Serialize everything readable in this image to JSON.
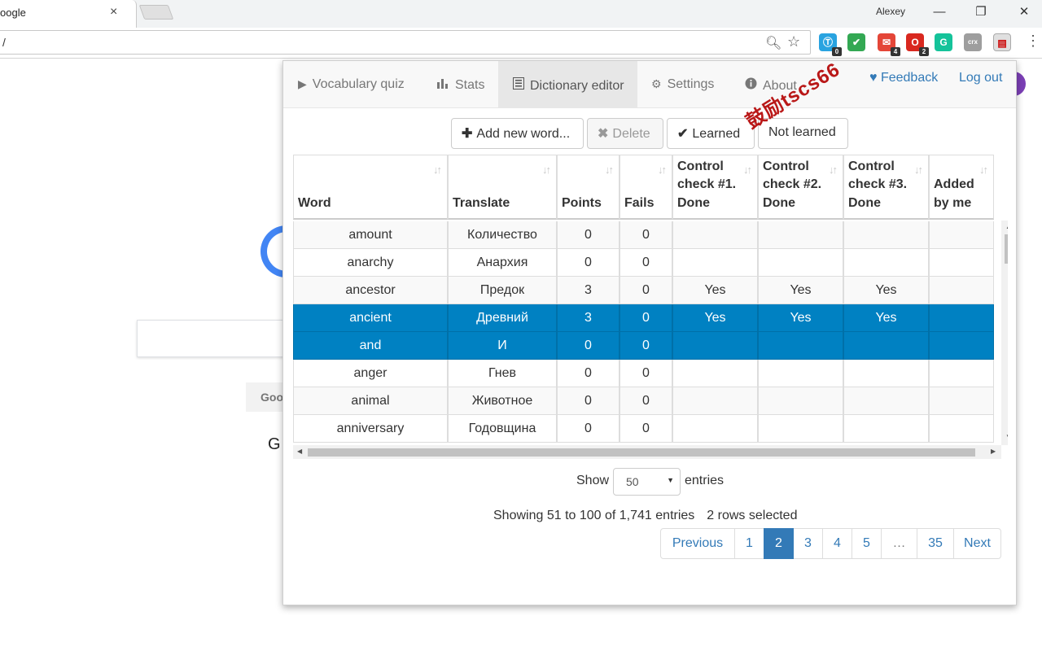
{
  "browser": {
    "tab_title": "oogle",
    "tab_close": "×",
    "profile_name": "Alexey",
    "minimize": "—",
    "restore": "❐",
    "close": "✕",
    "address": "/",
    "menu": "⋮",
    "extensions": [
      {
        "name": "translate-ext",
        "badge": "0",
        "color": "#29a3e0"
      },
      {
        "name": "check-ext",
        "badge": "",
        "color": "#33a853"
      },
      {
        "name": "mail-ext",
        "badge": "4",
        "color": "#e44638"
      },
      {
        "name": "opera-ext",
        "badge": "2",
        "color": "#d9281f"
      },
      {
        "name": "grammarly-ext",
        "badge": "",
        "color": "#15c39a"
      },
      {
        "name": "crx-ext",
        "badge": "",
        "color": "#9e9e9e"
      },
      {
        "name": "dictionary-ext",
        "badge": "",
        "color": "#e0e0e0"
      }
    ]
  },
  "google_page": {
    "button_fragment": "Goo",
    "text_fragment": "G"
  },
  "popup": {
    "nav": {
      "quiz": "Vocabulary quiz",
      "stats": "Stats",
      "editor": "Dictionary editor",
      "settings": "Settings",
      "about": "About",
      "feedback": "Feedback",
      "logout": "Log out"
    },
    "watermark": "鼓励tscs66",
    "toolbar": {
      "add": "Add new word...",
      "delete": "Delete",
      "learned": "Learned",
      "not_learned": "Not learned"
    },
    "table": {
      "columns": [
        "Word",
        "Translate",
        "Points",
        "Fails",
        "Control check #1. Done",
        "Control check #2. Done",
        "Control check #3. Done",
        "Added by me"
      ],
      "rows": [
        {
          "word": "amount",
          "translate": "Количество",
          "points": "0",
          "fails": "0",
          "c1": "",
          "c2": "",
          "c3": "",
          "added": "",
          "selected": false
        },
        {
          "word": "anarchy",
          "translate": "Анархия",
          "points": "0",
          "fails": "0",
          "c1": "",
          "c2": "",
          "c3": "",
          "added": "",
          "selected": false
        },
        {
          "word": "ancestor",
          "translate": "Предок",
          "points": "3",
          "fails": "0",
          "c1": "Yes",
          "c2": "Yes",
          "c3": "Yes",
          "added": "",
          "selected": false
        },
        {
          "word": "ancient",
          "translate": "Древний",
          "points": "3",
          "fails": "0",
          "c1": "Yes",
          "c2": "Yes",
          "c3": "Yes",
          "added": "",
          "selected": true
        },
        {
          "word": "and",
          "translate": "И",
          "points": "0",
          "fails": "0",
          "c1": "",
          "c2": "",
          "c3": "",
          "added": "",
          "selected": true
        },
        {
          "word": "anger",
          "translate": "Гнев",
          "points": "0",
          "fails": "0",
          "c1": "",
          "c2": "",
          "c3": "",
          "added": "",
          "selected": false
        },
        {
          "word": "animal",
          "translate": "Животное",
          "points": "0",
          "fails": "0",
          "c1": "",
          "c2": "",
          "c3": "",
          "added": "",
          "selected": false
        },
        {
          "word": "anniversary",
          "translate": "Годовщина",
          "points": "0",
          "fails": "0",
          "c1": "",
          "c2": "",
          "c3": "",
          "added": "",
          "selected": false
        }
      ]
    },
    "length": {
      "show": "Show",
      "value": "50",
      "entries": "entries"
    },
    "info": {
      "showing": "Showing 51 to 100 of 1,741 entries",
      "selected": "2 rows selected"
    },
    "pagination": [
      "Previous",
      "1",
      "2",
      "3",
      "4",
      "5",
      "…",
      "35",
      "Next"
    ],
    "current_page": "2",
    "colors": {
      "selected_row": "#0081c2",
      "link": "#337ab7"
    }
  }
}
